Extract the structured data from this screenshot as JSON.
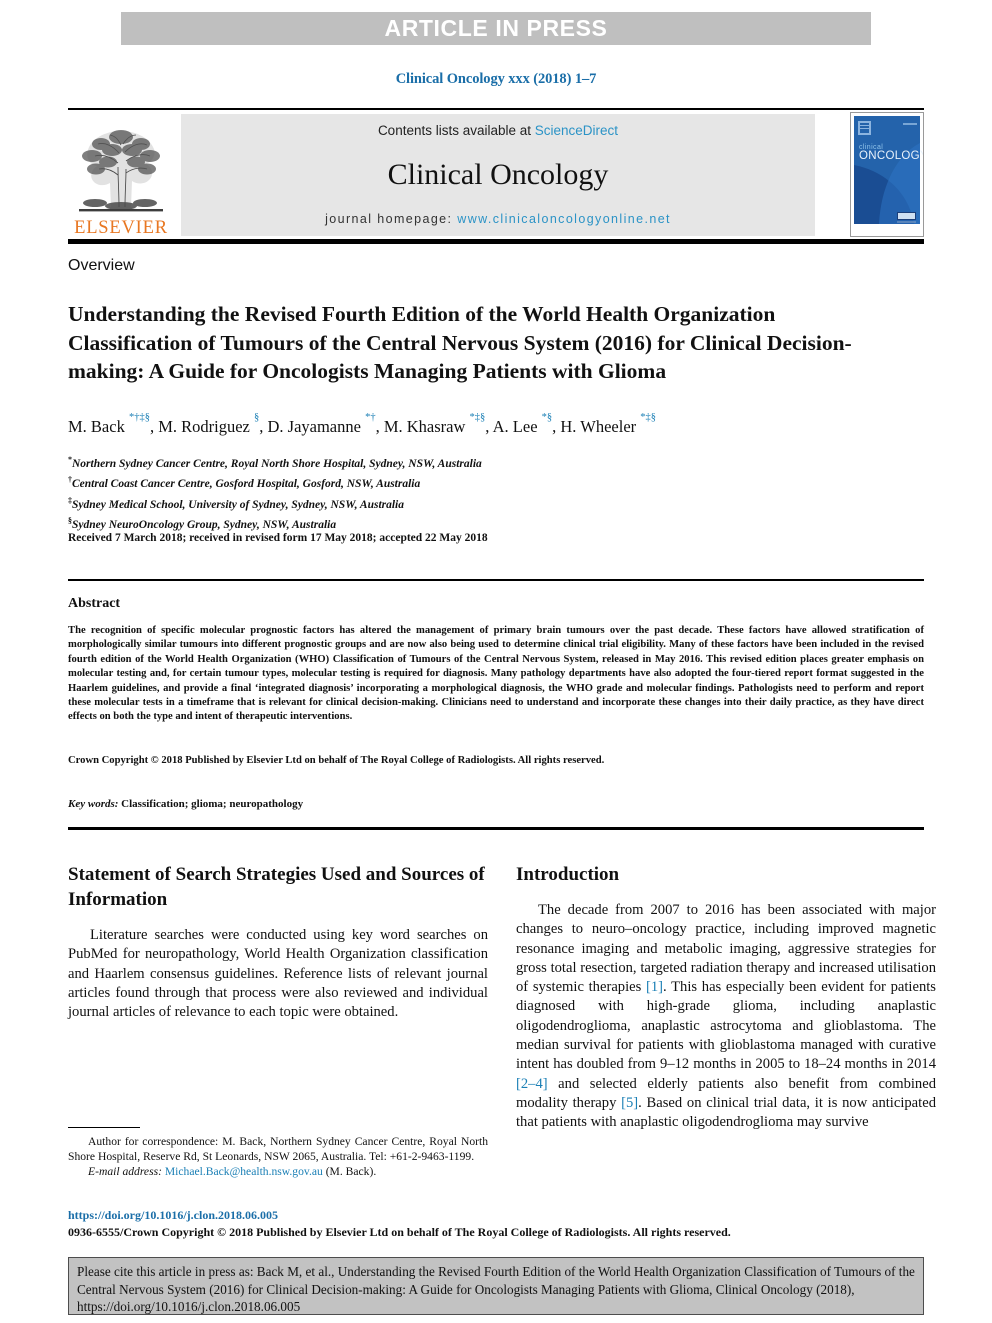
{
  "banner": {
    "text": "ARTICLE IN PRESS"
  },
  "journal_ref": "Clinical Oncology xxx (2018) 1–7",
  "masthead": {
    "publisher": "ELSEVIER",
    "contents_prefix": "Contents lists available at ",
    "contents_link": "ScienceDirect",
    "journal_name": "Clinical Oncology",
    "homepage_prefix": "journal homepage: ",
    "homepage_link": "www.clinicaloncologyonline.net",
    "cover_title_small": "clinical",
    "cover_title_large": "ONCOLOGY"
  },
  "article": {
    "section_label": "Overview",
    "title": "Understanding the Revised Fourth Edition of the World Health Organization Classification of Tumours of the Central Nervous System (2016) for Clinical Decision-making: A Guide for Oncologists Managing Patients with Glioma",
    "authors_html": "M. Back <sup>*†‡§</sup>, M. Rodriguez <sup>§</sup>, D. Jayamanne <sup>*†</sup>, M. Khasraw <sup>*‡§</sup>, A. Lee <sup>*§</sup>, H. Wheeler <sup>*‡§</sup>",
    "affiliations": [
      {
        "marker": "*",
        "text": "Northern Sydney Cancer Centre, Royal North Shore Hospital, Sydney, NSW, Australia"
      },
      {
        "marker": "†",
        "text": "Central Coast Cancer Centre, Gosford Hospital, Gosford, NSW, Australia"
      },
      {
        "marker": "‡",
        "text": "Sydney Medical School, University of Sydney, Sydney, NSW, Australia"
      },
      {
        "marker": "§",
        "text": "Sydney NeuroOncology Group, Sydney, NSW, Australia"
      }
    ],
    "history": "Received 7 March 2018; received in revised form 17 May 2018; accepted 22 May 2018"
  },
  "abstract": {
    "heading": "Abstract",
    "body": "The recognition of specific molecular prognostic factors has altered the management of primary brain tumours over the past decade. These factors have allowed stratification of morphologically similar tumours into different prognostic groups and are now also being used to determine clinical trial eligibility. Many of these factors have been included in the revised fourth edition of the World Health Organization (WHO) Classification of Tumours of the Central Nervous System, released in May 2016. This revised edition places greater emphasis on molecular testing and, for certain tumour types, molecular testing is required for diagnosis. Many pathology departments have also adopted the four-tiered report format suggested in the Haarlem guidelines, and provide a final ‘integrated diagnosis’ incorporating a morphological diagnosis, the WHO grade and molecular findings. Pathologists need to perform and report these molecular tests in a timeframe that is relevant for clinical decision-making. Clinicians need to understand and incorporate these changes into their daily practice, as they have direct effects on both the type and intent of therapeutic interventions.",
    "copyright": "Crown Copyright © 2018 Published by Elsevier Ltd on behalf of The Royal College of Radiologists. All rights reserved.",
    "keywords_label": "Key words:",
    "keywords_value": " Classification; glioma; neuropathology"
  },
  "left_column": {
    "heading": "Statement of Search Strategies Used and Sources of Information",
    "paragraph": "Literature searches were conducted using key word searches on PubMed for neuropathology, World Health Organization classification and Haarlem consensus guidelines. Reference lists of relevant journal articles found through that process were also reviewed and individual journal articles of relevance to each topic were obtained."
  },
  "right_column": {
    "heading": "Introduction",
    "paragraph_part1": "The decade from 2007 to 2016 has been associated with major changes to neuro–oncology practice, including improved magnetic resonance imaging and metabolic imaging, aggressive strategies for gross total resection, targeted radiation therapy and increased utilisation of systemic therapies ",
    "ref1": "[1]",
    "paragraph_part2": ". This has especially been evident for patients diagnosed with high-grade glioma, including anaplastic oligodendroglioma, anaplastic astrocytoma and glioblastoma. The median survival for patients with glioblastoma managed with curative intent has doubled from 9–12 months in 2005 to 18–24 months in 2014 ",
    "ref2": "[2–4]",
    "paragraph_part3": " and selected elderly patients also benefit from combined modality therapy ",
    "ref3": "[5]",
    "paragraph_part4": ". Based on clinical trial data, it is now anticipated that patients with anaplastic oligodendroglioma may survive"
  },
  "footnote": {
    "correspondence": "Author for correspondence: M. Back, Northern Sydney Cancer Centre, Royal North Shore Hospital, Reserve Rd, St Leonards, NSW 2065, Australia. Tel: +61-2-9463-1199.",
    "email_label": "E-mail address:",
    "email_value": "Michael.Back@health.nsw.gov.au",
    "email_suffix": " (M. Back)."
  },
  "bottom": {
    "doi": "https://doi.org/10.1016/j.clon.2018.06.005",
    "copyright": "0936-6555/Crown Copyright © 2018 Published by Elsevier Ltd on behalf of The Royal College of Radiologists. All rights reserved."
  },
  "cite_box": {
    "text": "Please cite this article in press as: Back M, et al., Understanding the Revised Fourth Edition of the World Health Organization Classification of Tumours of the Central Nervous System (2016) for Clinical Decision-making: A Guide for Oncologists Managing Patients with Glioma, Clinical Oncology (2018), https://doi.org/10.1016/j.clon.2018.06.005"
  },
  "colors": {
    "banner_bg": "#bfbfbf",
    "link_blue": "#1a7fb5",
    "journal_ref_blue": "#1a6ea8",
    "elsevier_orange": "#e87722",
    "masthead_gray": "#e6e6e6",
    "cite_box_gray": "#c2c2c2",
    "cover_blue": "#1b5fa8"
  }
}
